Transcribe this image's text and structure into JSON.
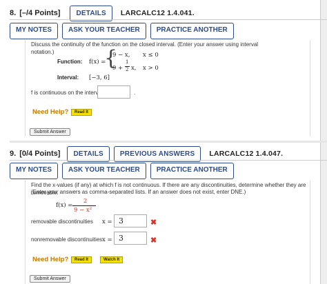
{
  "q1": {
    "number": "8.",
    "points": "[–/4 Points]",
    "details_label": "DETAILS",
    "code": "LARCALC12 1.4.041.",
    "toolbar": [
      "MY NOTES",
      "ASK YOUR TEACHER",
      "PRACTICE ANOTHER"
    ],
    "prompt": "Discuss the continuity of the function on the closed interval. (Enter your answer using interval notation.)",
    "function_label": "Function:",
    "fx": "f(x) =",
    "piece1_expr": "9 − x,",
    "piece1_cond": "x ≤ 0",
    "piece2_expr_a": "9 +",
    "piece2_frac_num": "1",
    "piece2_frac_den": "2",
    "piece2_expr_b": "x,",
    "piece2_cond": "x > 0",
    "interval_label": "Interval:",
    "interval_value": "[−3, 6]",
    "continuous_text": "f is continuous on the interval",
    "continuous_answer": "",
    "period": ".",
    "need_help": "Need Help?",
    "read_it": "Read It",
    "submit": "Submit Answer"
  },
  "q2": {
    "number": "9.",
    "points": "[0/4 Points]",
    "details_label": "DETAILS",
    "prev_label": "PREVIOUS ANSWERS",
    "code": "LARCALC12 1.4.047.",
    "toolbar": [
      "MY NOTES",
      "ASK YOUR TEACHER",
      "PRACTICE ANOTHER"
    ],
    "prompt_line1": "Find the x-values (if any) at which f is not continuous. If there are any discontinuities, determine whether they are removable.",
    "prompt_line2": "(Enter your answers as comma-separated lists. If an answer does not exist, enter DNE.)",
    "fx": "f(x) =",
    "frac_num": "2",
    "frac_den": "9 − x²",
    "removable_label": "removable discontinuities",
    "nonremovable_label": "nonremovable discontinuities",
    "x_eq": "x =",
    "removable_value": "3",
    "nonremovable_value": "3",
    "wrong_mark": "✖",
    "need_help": "Need Help?",
    "read_it": "Read It",
    "watch_it": "Watch It",
    "submit": "Submit Answer"
  },
  "colors": {
    "accent": "#2c4a8a",
    "help": "#c77a00",
    "button_yellow": "#f5e000",
    "error": "#d9342b"
  }
}
